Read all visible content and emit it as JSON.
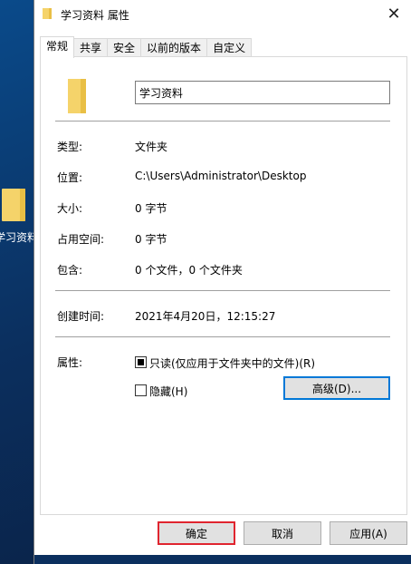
{
  "window": {
    "title": "学习资料 属性",
    "close_glyph": "✕"
  },
  "desktop": {
    "icon_label": "学习资料"
  },
  "tabs": [
    {
      "label": "常规"
    },
    {
      "label": "共享"
    },
    {
      "label": "安全"
    },
    {
      "label": "以前的版本"
    },
    {
      "label": "自定义"
    }
  ],
  "general": {
    "name_value": "学习资料",
    "type_label": "类型:",
    "type_value": "文件夹",
    "location_label": "位置:",
    "location_value": "C:\\Users\\Administrator\\Desktop",
    "size_label": "大小:",
    "size_value": "0 字节",
    "size_on_disk_label": "占用空间:",
    "size_on_disk_value": "0 字节",
    "contains_label": "包含:",
    "contains_value": "0 个文件，0 个文件夹",
    "created_label": "创建时间:",
    "created_value": "2021年4月20日，12:15:27",
    "attributes_label": "属性:",
    "readonly_label": "只读(仅应用于文件夹中的文件)(R)",
    "readonly_checked": true,
    "hidden_label": "隐藏(H)",
    "hidden_checked": false,
    "advanced_button": "高级(D)..."
  },
  "buttons": {
    "ok": "确定",
    "cancel": "取消",
    "apply": "应用(A)"
  },
  "colors": {
    "folder": "#f5d36a",
    "focus_blue": "#0078d7",
    "ok_highlight": "#e0252f"
  }
}
